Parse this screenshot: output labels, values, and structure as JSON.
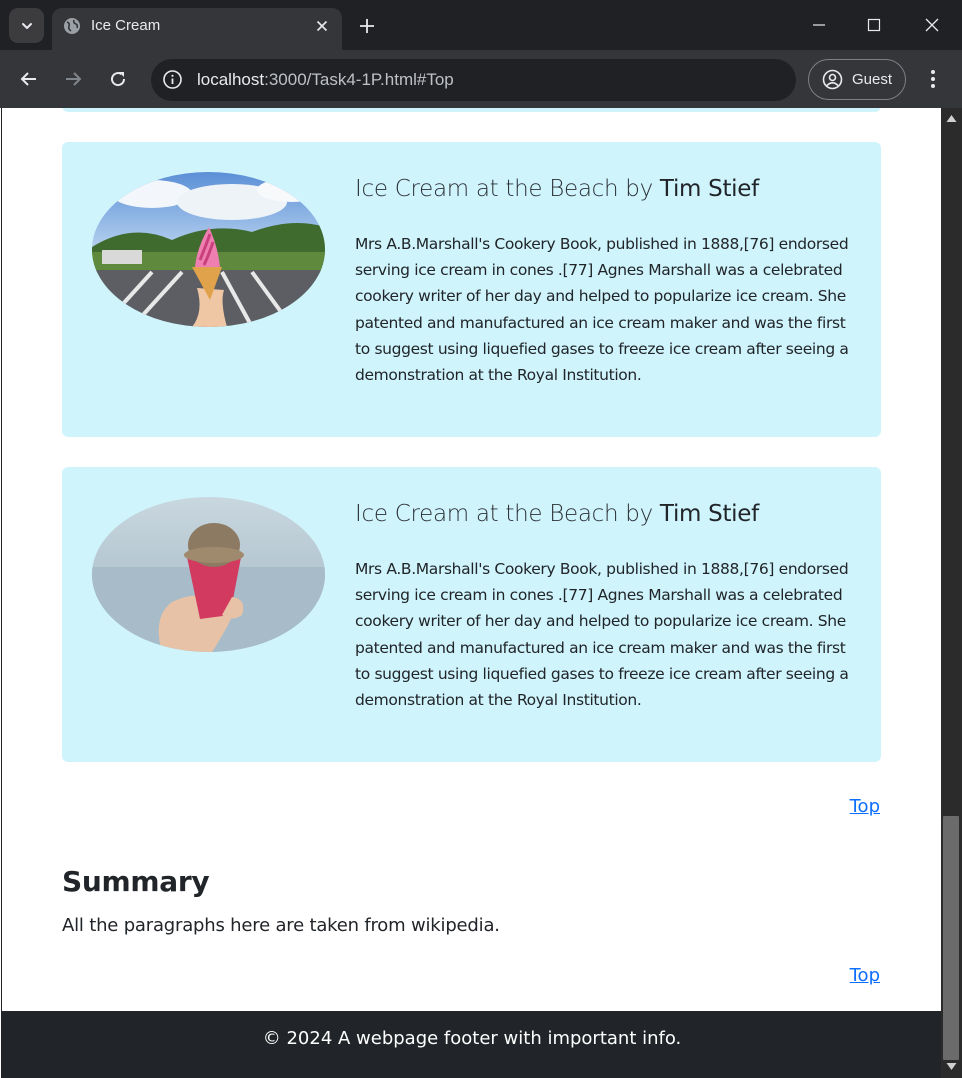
{
  "browser": {
    "tab_title": "Ice Cream",
    "url_host": "localhost",
    "url_path": ":3000/Task4-1P.html#Top",
    "profile_label": "Guest"
  },
  "cards": [
    {
      "title_prefix": "Ice Cream at the Beach by ",
      "author": "Tim Stief",
      "text": "Mrs A.B.Marshall's Cookery Book, published in 1888,[76] endorsed serving ice cream in cones .[77] Agnes Marshall was a celebrated cookery writer of her day and helped to popularize ice cream. She patented and manufactured an ice cream maker and was the first to suggest using liquefied gases to freeze ice cream after seeing a demonstration at the Royal Institution."
    },
    {
      "title_prefix": "Ice Cream at the Beach by ",
      "author": "Tim Stief",
      "text": "Mrs A.B.Marshall's Cookery Book, published in 1888,[76] endorsed serving ice cream in cones .[77] Agnes Marshall was a celebrated cookery writer of her day and helped to popularize ice cream. She patented and manufactured an ice cream maker and was the first to suggest using liquefied gases to freeze ice cream after seeing a demonstration at the Royal Institution."
    }
  ],
  "top_link_label": "Top",
  "summary": {
    "heading": "Summary",
    "text": "All the paragraphs here are taken from wikipedia."
  },
  "footer": {
    "text": "© 2024 A webpage footer with important info."
  },
  "colors": {
    "card_bg": "#cff4fc",
    "link": "#0d6efd",
    "footer_bg": "#212529"
  }
}
